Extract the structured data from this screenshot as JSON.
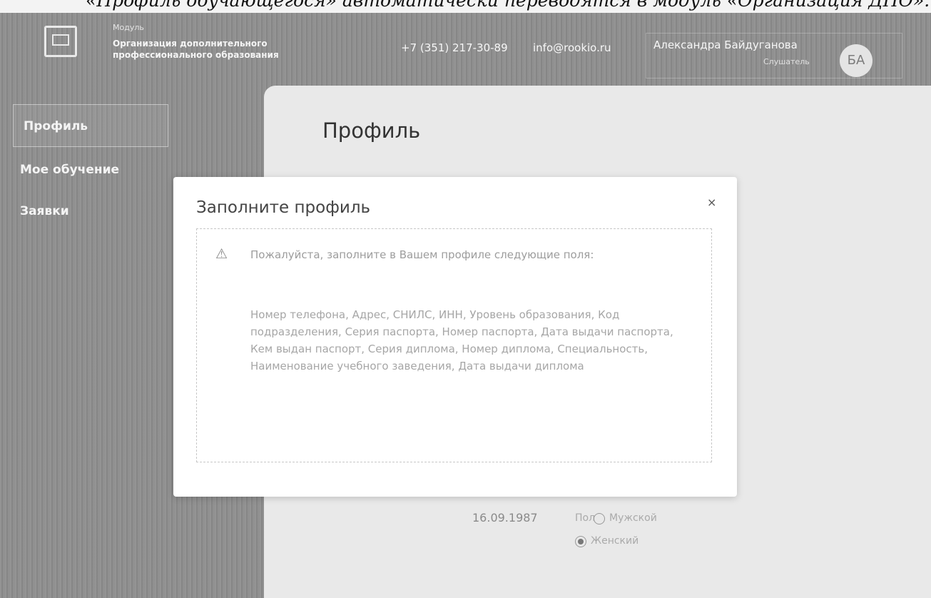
{
  "caption": "«Профиль обучающегося» автоматически переводятся в модуль «Организация ДПО».",
  "header": {
    "module_label": "Модуль",
    "module_title": "Организация дополнительного профессионального образования",
    "phone": "+7 (351) 217-30-89",
    "email": "info@rookio.ru",
    "user_name": "Александра Байдуганова",
    "user_role": "Слушатель",
    "avatar_initials": "БА"
  },
  "sidebar": {
    "items": [
      {
        "label": "Профиль",
        "active": true
      },
      {
        "label": "Мое обучение",
        "active": false
      },
      {
        "label": "Заявки",
        "active": false
      }
    ]
  },
  "page": {
    "title": "Профиль",
    "background_date": "16.09.1987",
    "gender_label": "Пол",
    "gender_options": [
      "Мужской",
      "Женский"
    ],
    "selected_gender": "Женский"
  },
  "modal": {
    "title": "Заполните профиль",
    "close": "×",
    "message": "Пожалуйста, заполните в Вашем профиле следующие поля:",
    "fields": "Номер телефона, Адрес, СНИЛС, ИНН, Уровень образования, Код подразделения, Серия паспорта, Номер паспорта, Дата выдачи паспорта, Кем выдан паспорт, Серия диплома, Номер диплома, Специальность, Наименование учебного заведения, Дата выдачи диплома"
  },
  "icons": {
    "logo": "module-logo-icon",
    "warning": "warning-icon",
    "close": "close-icon"
  }
}
